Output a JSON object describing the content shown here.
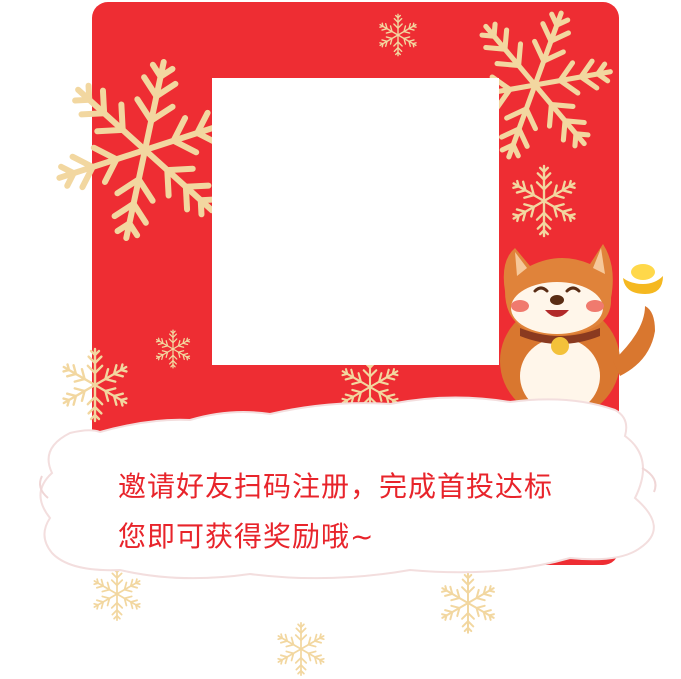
{
  "invite": {
    "line1": "邀请好友扫码注册，完成首投达标",
    "line2": "您即可获得奖励哦~"
  },
  "colors": {
    "card_red": "#ee2d33",
    "snow_gold": "#f2d7a0",
    "text_red": "#e8242b"
  },
  "icons": [
    "snowflake-icon",
    "dog-mascot-icon",
    "gold-ingot-icon",
    "qr-code-placeholder"
  ]
}
